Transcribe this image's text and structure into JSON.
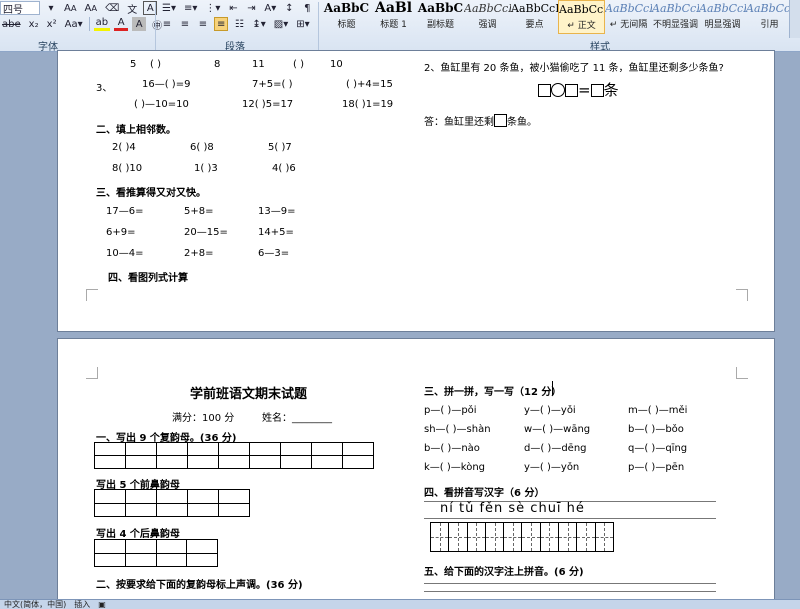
{
  "ribbon": {
    "font_group": "字体",
    "paragraph_group": "段落",
    "styles_group": "样式",
    "font_name": "四号",
    "styles": [
      {
        "sample": "AaBbC",
        "name": "标题"
      },
      {
        "sample": "AaBl",
        "name": "标题 1"
      },
      {
        "sample": "AaBbC",
        "name": "副标题"
      },
      {
        "sample": "AaBbCcD",
        "name": "强调"
      },
      {
        "sample": "AaBbCcD",
        "name": "要点"
      },
      {
        "sample": "AaBbCcDc",
        "name": "↵ 正文"
      },
      {
        "sample": "AaBbCcDc",
        "name": "↵ 无间隔"
      },
      {
        "sample": "AaBbCcDc",
        "name": "不明显强调"
      },
      {
        "sample": "AaBbCcDc",
        "name": "明显强调"
      },
      {
        "sample": "AaBbCcDc",
        "name": "引用"
      }
    ]
  },
  "page1": {
    "row_top": [
      "5",
      "(    )",
      "8",
      "11",
      "(    )",
      "10"
    ],
    "q3_num": "3、",
    "q3_items": [
      "16—(    )=9",
      "7+5=(        )",
      "(    )+4=15"
    ],
    "q3_items2": [
      "(    )—10=10",
      "12(    )5=17",
      "18(    )1=19"
    ],
    "sec2": "二、填上相邻数。",
    "neighbors1": [
      "2(      )4",
      "6(      )8",
      "5(      )7"
    ],
    "neighbors2": [
      "8(    )10",
      "1(      )3",
      "4(      )6"
    ],
    "sec3": "三、看推算得又对又快。",
    "calc1": [
      "17—6=",
      "5+8=",
      "13—9="
    ],
    "calc2": [
      "6+9=",
      "20—15=",
      "14+5="
    ],
    "calc3": [
      "10—4=",
      "2+8=",
      "6—3="
    ],
    "sec4": "四、看图列式计算",
    "right_q2": "2、鱼缸里有 20 条鱼，被小猫偷吃了 11 条，鱼缸里还剩多少条鱼?",
    "equation_tail": "条",
    "answer_prefix": "答：鱼缸里还剩",
    "answer_suffix": "条鱼。"
  },
  "page2": {
    "title": "学前班语文期末试题",
    "score": "满分：100 分",
    "name": "姓名：________",
    "s1": "一、写出 9 个复韵母。(36 分)",
    "s1b": "写出 5 个前鼻韵母",
    "s1c": "写出 4 个后鼻韵母",
    "s2": "二、按要求给下面的复韵母标上声调。(36 分)",
    "s3": "三、拼一拼，写一写（12 分）",
    "pinyin_rows": [
      [
        "p—(      )—pǒi",
        "y—(      )—yǒi",
        "m—(      )—měi"
      ],
      [
        "sh—(      )—shàn",
        "w—(      )—wāng",
        "b—(      )—bǒo"
      ],
      [
        "b—(      )—nào",
        "d—(      )—dēng",
        "q—(      )—qīng"
      ],
      [
        "k—(      )—kòng",
        "y—(      )—yǒn",
        "p—(      )—pēn"
      ]
    ],
    "s4": "四、看拼音写汉字（6 分）",
    "pinyin_words": "ní  tǔ  fěn  sè  chuī  hé",
    "s5": "五、给下面的汉字注上拼音。(6 分)"
  },
  "status": {
    "lang": "中文(简体，中国)",
    "mode": "插入"
  }
}
